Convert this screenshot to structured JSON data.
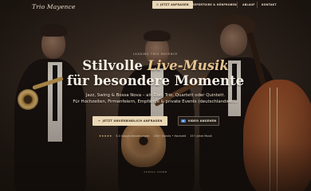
{
  "nav": {
    "logo": "Trio Mayence",
    "cta_icon": "✉",
    "cta_label": "JETZT ANFRAGEN",
    "links": [
      "REPERTOIRE & HÖRPROBEN",
      "ABLAUF",
      "KONTAKT"
    ]
  },
  "hero": {
    "kicker": "LEADING TRIO MAYENCE",
    "title_line1_prefix": "Stilvolle ",
    "title_line1_accent": "Live-Musik",
    "title_line2": "für besondere Momente",
    "subtitle_line1": "Jazz, Swing & Bossa Nova – als Duo, Trio, Quartett oder Quintett.",
    "subtitle_line2": "Für Hochzeiten, Firmenfeiern, Empfänge & private Events (deutschlandweit)."
  },
  "buttons": {
    "primary_icon": "→",
    "primary_label": "JETZT UNVERBINDLICH ANFRAGEN",
    "secondary_label": "VIDEO ANSEHEN"
  },
  "stats": {
    "stars": "★★★★★",
    "rating_text": "5.0 Google-Bewertungen",
    "events": "250+ Events • Hochzeit",
    "years": "15+ Jahre Musik"
  },
  "scroll_hint": "SCROLL DOWN",
  "colors": {
    "accent": "#e6c48f",
    "cta_bg": "#ead8b6",
    "video_icon": "#4a86d8"
  }
}
